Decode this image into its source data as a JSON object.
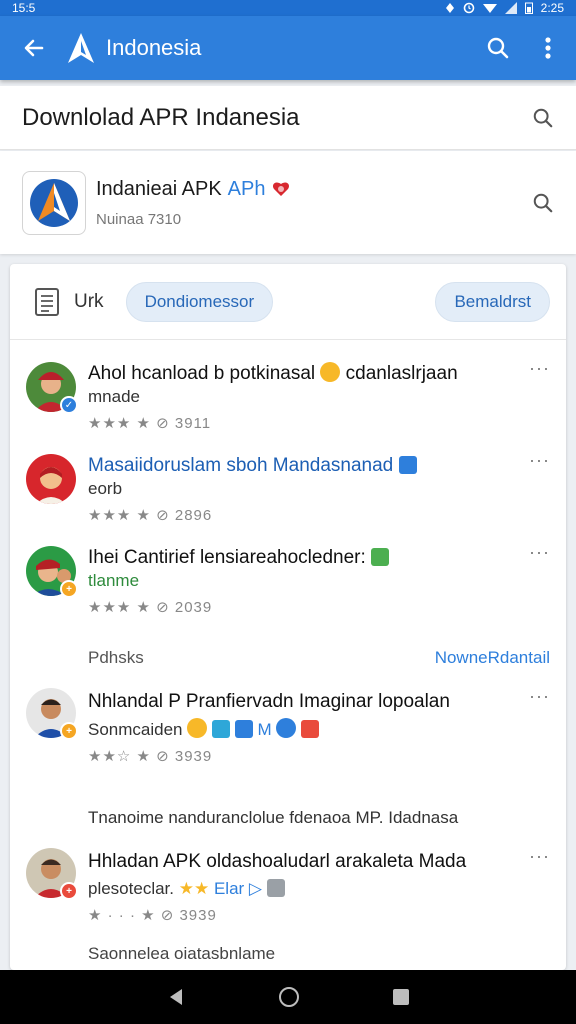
{
  "status_bar": {
    "time": "15:5",
    "clock_right": "2:25"
  },
  "app_bar": {
    "title": "Indonesia"
  },
  "search_row": {
    "text": "Downlolad APR Indanesia"
  },
  "app_row": {
    "name": "Indanieai APK",
    "name_accent": "APh",
    "sub": "Nuinaa  7310"
  },
  "card": {
    "label": "Urk",
    "chip_left": "Dondiomessor",
    "chip_right": "Bemaldrst"
  },
  "reviews": [
    {
      "title": "Ahol hcanload b potkinasal",
      "title_after": "cdanlaslrjaan",
      "sub": "mnade",
      "rating": "★★★ ★  ⊘ 3911",
      "more": "···"
    },
    {
      "title": "Masaiidoruslam sboh Mandasnanad",
      "sub": "eorb",
      "rating": "★★★ ★  ⊘ 2896",
      "more": "···"
    },
    {
      "title": "Ihei Cantirief lensiareahocledner:",
      "sub": "tlanme",
      "rating": "★★★ ★  ⊘ 2039",
      "more": "···"
    },
    {
      "title": "Nhlandal P Pranfiervadn Imaginar lopoalan",
      "sub": "Sonmcaiden",
      "sub_icons": "M",
      "rating": "★★☆ ★  ⊘ 3939",
      "more": "···"
    },
    {
      "title": "Hhladan APK oldashoaludarl arakaleta Mada",
      "sub": "plesoteclar.",
      "sub_icons": "Elar",
      "rating": "★ · · · ★  ⊘ 3939",
      "more": "···"
    }
  ],
  "section": {
    "label": "Pdhsks",
    "link": "NowneRdantail"
  },
  "section_text": "Tnanoime nanduranclolue fdenaoa MP. Idadnasa",
  "footer_text": "Saonnelea oiatasbnlame",
  "colors": {
    "accent": "#2e7fdc",
    "status_bar": "#1f6fd0",
    "nav_bar": "#000000"
  }
}
